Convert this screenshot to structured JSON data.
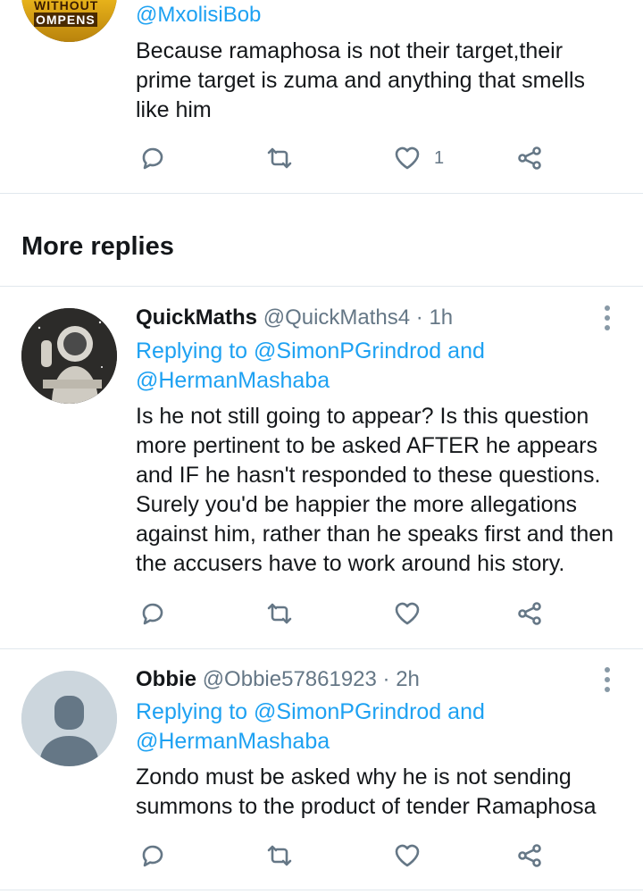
{
  "top_tweet": {
    "avatar_text_1": "WITHOUT",
    "avatar_text_2": "OMPENS",
    "handle": "@MxolisiBob",
    "text": "Because ramaphosa is not their target,their prime target is zuma and anything that smells like him",
    "like_count": "1"
  },
  "section": {
    "title": "More replies"
  },
  "replies": [
    {
      "name": "QuickMaths",
      "handle": "@QuickMaths4",
      "time": "· 1h",
      "replying_prefix": "Replying to ",
      "replying_to_1": "@SimonPGrindrod",
      "replying_and": " and",
      "replying_to_2": "@HermanMashaba",
      "text": "Is he not still going to appear? Is this question more pertinent to be asked AFTER he appears and IF he hasn't responded to these questions. Surely you'd be happier the more allegations against him, rather than he speaks first and then the accusers have to work around his story."
    },
    {
      "name": "Obbie",
      "handle": "@Obbie57861923",
      "time": "· 2h",
      "replying_prefix": "Replying to ",
      "replying_to_1": "@SimonPGrindrod",
      "replying_and": " and",
      "replying_to_2": "@HermanMashaba",
      "text": "Zondo must be asked why he is not sending summons to the product of tender Ramaphosa"
    }
  ],
  "icons": {
    "reply": "reply-icon",
    "retweet": "retweet-icon",
    "like": "heart-icon",
    "share": "share-icon",
    "more": "more-vertical-icon"
  },
  "colors": {
    "icon_gray": "#657786",
    "link_blue": "#1da1f2",
    "divider": "#e1e8ed"
  }
}
